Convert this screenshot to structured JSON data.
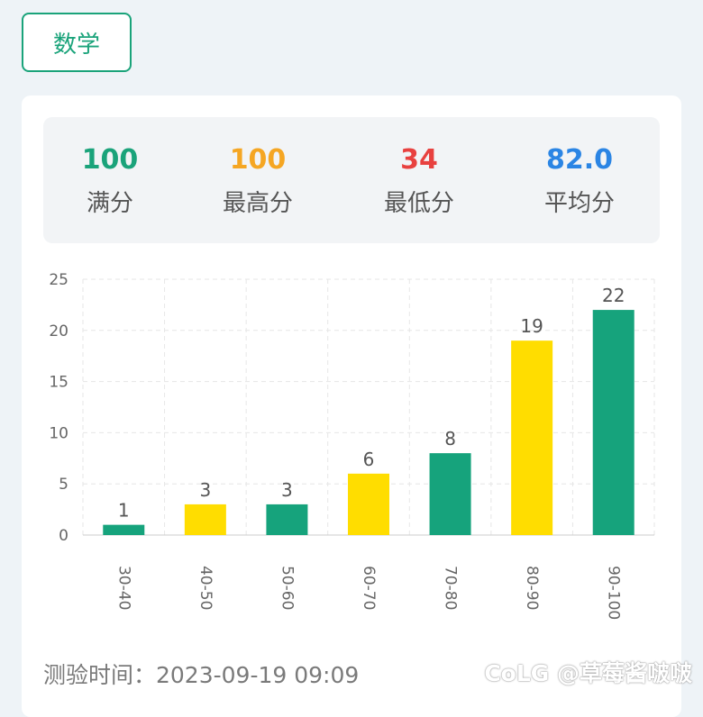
{
  "subject_tab": {
    "label": "数学"
  },
  "stats": [
    {
      "value": "100",
      "label": "满分",
      "color": "#1aa37a"
    },
    {
      "value": "100",
      "label": "最高分",
      "color": "#f5a623"
    },
    {
      "value": "34",
      "label": "最低分",
      "color": "#e8413f"
    },
    {
      "value": "82.0",
      "label": "平均分",
      "color": "#2b85e4"
    }
  ],
  "chart_data": {
    "type": "bar",
    "categories": [
      "30-40",
      "40-50",
      "50-60",
      "60-70",
      "70-80",
      "80-90",
      "90-100"
    ],
    "values": [
      1,
      3,
      3,
      6,
      8,
      19,
      22
    ],
    "bar_colors": [
      "#16a37c",
      "#ffdd00",
      "#16a37c",
      "#ffdd00",
      "#16a37c",
      "#ffdd00",
      "#16a37c"
    ],
    "y_ticks": [
      0,
      5,
      10,
      15,
      20,
      25
    ],
    "ylim": [
      0,
      25
    ],
    "grid": true,
    "data_labels": true,
    "x_tick_rotation": "vertical"
  },
  "footer": {
    "test_time": "测验时间：2023-09-19 09:09"
  },
  "watermark": {
    "text": "CoLG @草莓酱啵啵"
  }
}
